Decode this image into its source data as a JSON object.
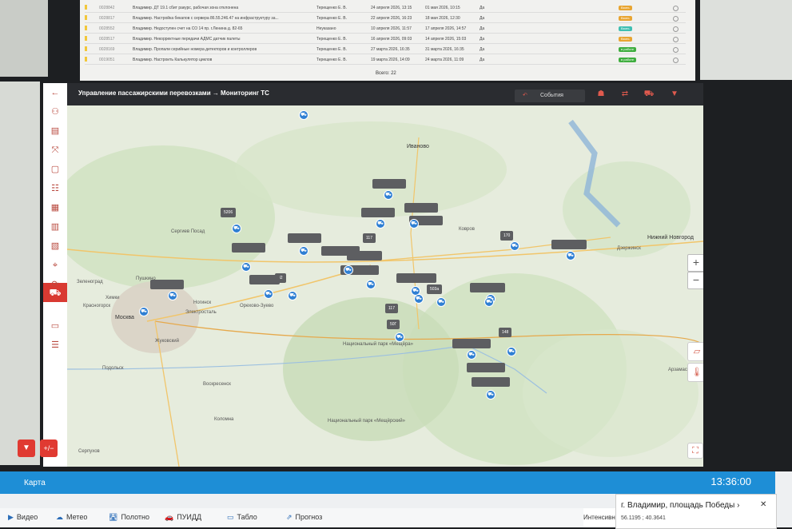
{
  "tasks": {
    "rows": [
      {
        "id": "0028842",
        "desc": "Владимир. ДТ 19.1 сбит ракурс, рабочая зона отклонена",
        "user": "Терещенко Е. В.",
        "d1": "24 апреля 2026, 13:15",
        "d2": "01 мая 2026, 10:15",
        "status": "Да",
        "badge": "Взять",
        "badge_color": "#e8a532",
        "mark": "#f2c73b"
      },
      {
        "id": "0028817",
        "desc": "Владимир. Настройка бекапов с сервера 86.55.246.47 на инфраструктуру за...",
        "user": "Терещенко Е. В.",
        "d1": "22 апреля 2026, 16:23",
        "d2": "18 мая 2026, 12:30",
        "status": "Да",
        "badge": "Взять",
        "badge_color": "#e8a532",
        "mark": "#f2c73b"
      },
      {
        "id": "0028552",
        "desc": "Владимир. Недоступен счет на СО 14 пр. г.Ленина д. 82-65",
        "user": "Неуказано",
        "d1": "10 апреля 2026, 11:57",
        "d2": "17 апреля 2026, 14:57",
        "status": "Да",
        "badge": "Взять",
        "badge_color": "#3fbfb2",
        "mark": "#f2c73b"
      },
      {
        "id": "0028517",
        "desc": "Владимир. Некорректные передачи АДМС датчик палеты",
        "user": "Терещенко Е. В.",
        "d1": "16 апреля 2026, 09:03",
        "d2": "14 апреля 2026, 15:03",
        "status": "Да",
        "badge": "Взять",
        "badge_color": "#e8a532",
        "mark": "#f2c73b"
      },
      {
        "id": "0028169",
        "desc": "Владимир. Пропали серийные номера детекторов и контроллеров",
        "user": "Терещенко Е. В.",
        "d1": "27 марта 2026, 16:35",
        "d2": "31 марта 2026, 16:35",
        "status": "Да",
        "badge": "в работе",
        "badge_color": "#3fae3f",
        "mark": "#f2c73b"
      },
      {
        "id": "0019051",
        "desc": "Владимир. Настроить Калькулятор циклов",
        "user": "Терещенко Е. В.",
        "d1": "19 марта 2026, 14:09",
        "d2": "24 марта 2026, 11:09",
        "status": "Да",
        "badge": "в работе",
        "badge_color": "#3fae3f",
        "mark": "#f2c73b"
      }
    ],
    "total": "Всего: 22"
  },
  "map_panel": {
    "title": "Управление пассажирскими перевозками → Мониторинг ТС",
    "events_label": "События",
    "header_icons": [
      "people-icon",
      "shuffle-icon",
      "bus-icon",
      "filter-icon"
    ],
    "sidebar_icons": [
      "back-arrow-icon",
      "org-chart-icon",
      "document-icon",
      "network-icon",
      "file-icon",
      "checklist-icon",
      "calendar-icon",
      "report-icon",
      "route-icon",
      "location-pin-icon",
      "refresh-icon",
      "transport-icon",
      "list-icon",
      "settings-sliders-icon"
    ],
    "cities": [
      {
        "name": "Иваново",
        "big": true
      },
      {
        "name": "Нижний Новгород",
        "big": true
      },
      {
        "name": "Ковров",
        "big": false
      },
      {
        "name": "Москва",
        "big": true
      },
      {
        "name": "Сергиев Посад",
        "big": false
      },
      {
        "name": "Зеленоград",
        "big": false
      },
      {
        "name": "Красногорск",
        "big": false
      },
      {
        "name": "Ногинск",
        "big": false
      },
      {
        "name": "Электросталь",
        "big": false
      },
      {
        "name": "Орехово-Зуево",
        "big": false
      },
      {
        "name": "Жуковский",
        "big": false
      },
      {
        "name": "Подольск",
        "big": false
      },
      {
        "name": "Воскресенск",
        "big": false
      },
      {
        "name": "Коломна",
        "big": false
      },
      {
        "name": "Серпухов",
        "big": false
      },
      {
        "name": "Дзержинск",
        "big": false
      },
      {
        "name": "Арзамас",
        "big": false
      },
      {
        "name": "Пушкино",
        "big": false
      },
      {
        "name": "Химки",
        "big": false
      },
      {
        "name": "Национальный парк «Мещёра»",
        "big": false
      },
      {
        "name": "Национальный парк «Мещёрский»",
        "big": false
      }
    ],
    "markers": [
      "5206",
      "117",
      "82",
      "170",
      "503а",
      "117",
      "50Г",
      "148"
    ],
    "zoom_in": "+",
    "zoom_out": "−",
    "filter_fab": "filter-icon",
    "plusminus_fab": "+/−",
    "fullscreen": "⛶"
  },
  "bottom": {
    "title": "Карта",
    "time": "13:36:00",
    "tabs": [
      {
        "label": "Видео",
        "icon": "▶"
      },
      {
        "label": "Метео",
        "icon": "☁"
      },
      {
        "label": "Полотно",
        "icon": "🛣"
      },
      {
        "label": "ПУИДД",
        "icon": "🚗"
      },
      {
        "label": "Табло",
        "icon": "▭"
      },
      {
        "label": "Прогноз",
        "icon": "⇗"
      }
    ],
    "intensity": "Интенсивность",
    "location_title": "г. Владимир, площадь Победы",
    "location_coords": "56.1195 ; 40.3641",
    "close": "✕"
  }
}
